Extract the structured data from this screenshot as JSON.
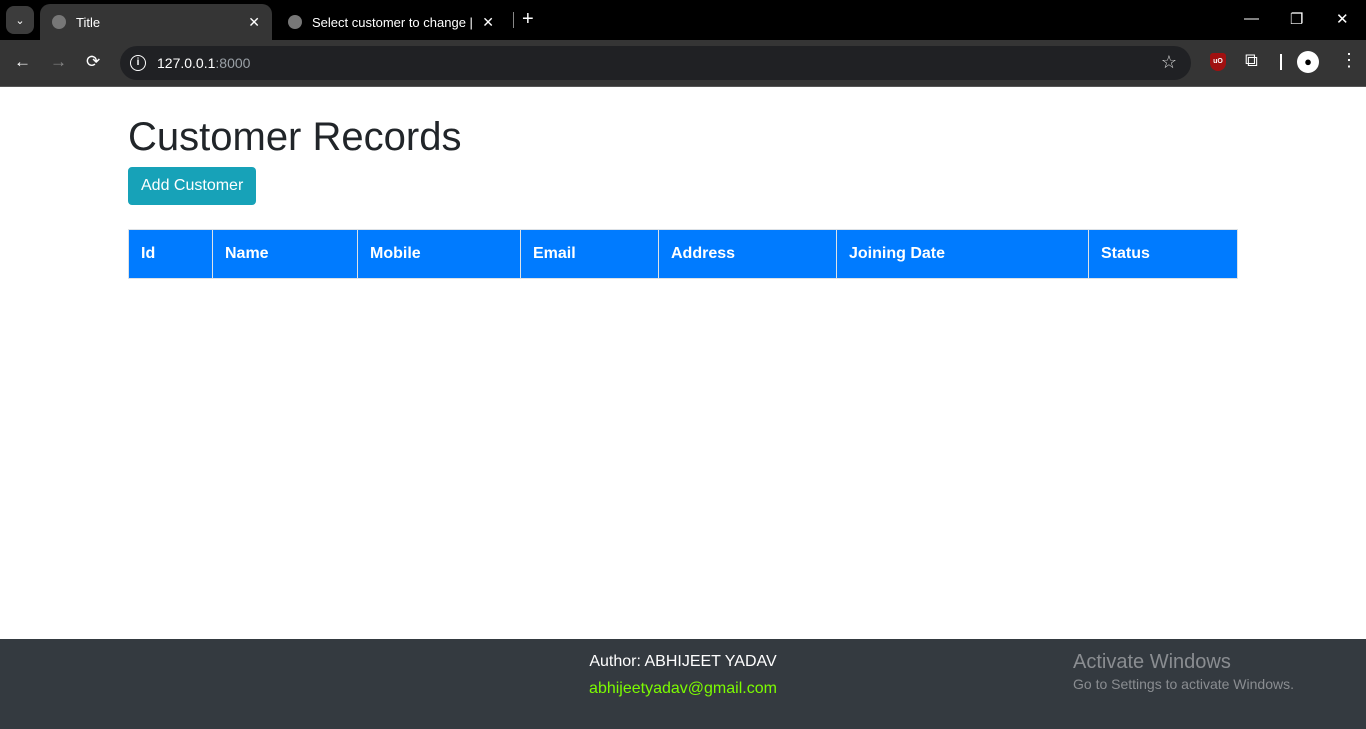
{
  "browser": {
    "tabs": [
      {
        "title": "Title",
        "active": true
      },
      {
        "title": "Select customer to change | Dja",
        "active": false
      }
    ],
    "url_host": "127.0.0.1",
    "url_port": ":8000"
  },
  "page": {
    "title": "Customer Records",
    "add_button": "Add Customer",
    "table": {
      "columns": [
        "Id",
        "Name",
        "Mobile",
        "Email",
        "Address",
        "Joining Date",
        "Status"
      ],
      "rows": []
    }
  },
  "footer": {
    "author": "Author: ABHIJEET YADAV",
    "email": "abhijeetyadav@gmail.com"
  },
  "watermark": {
    "title": "Activate Windows",
    "subtitle": "Go to Settings to activate Windows."
  },
  "colors": {
    "header": "#007bff",
    "button": "#17a2b8",
    "footer": "#343a40",
    "email": "#7CFC00"
  }
}
